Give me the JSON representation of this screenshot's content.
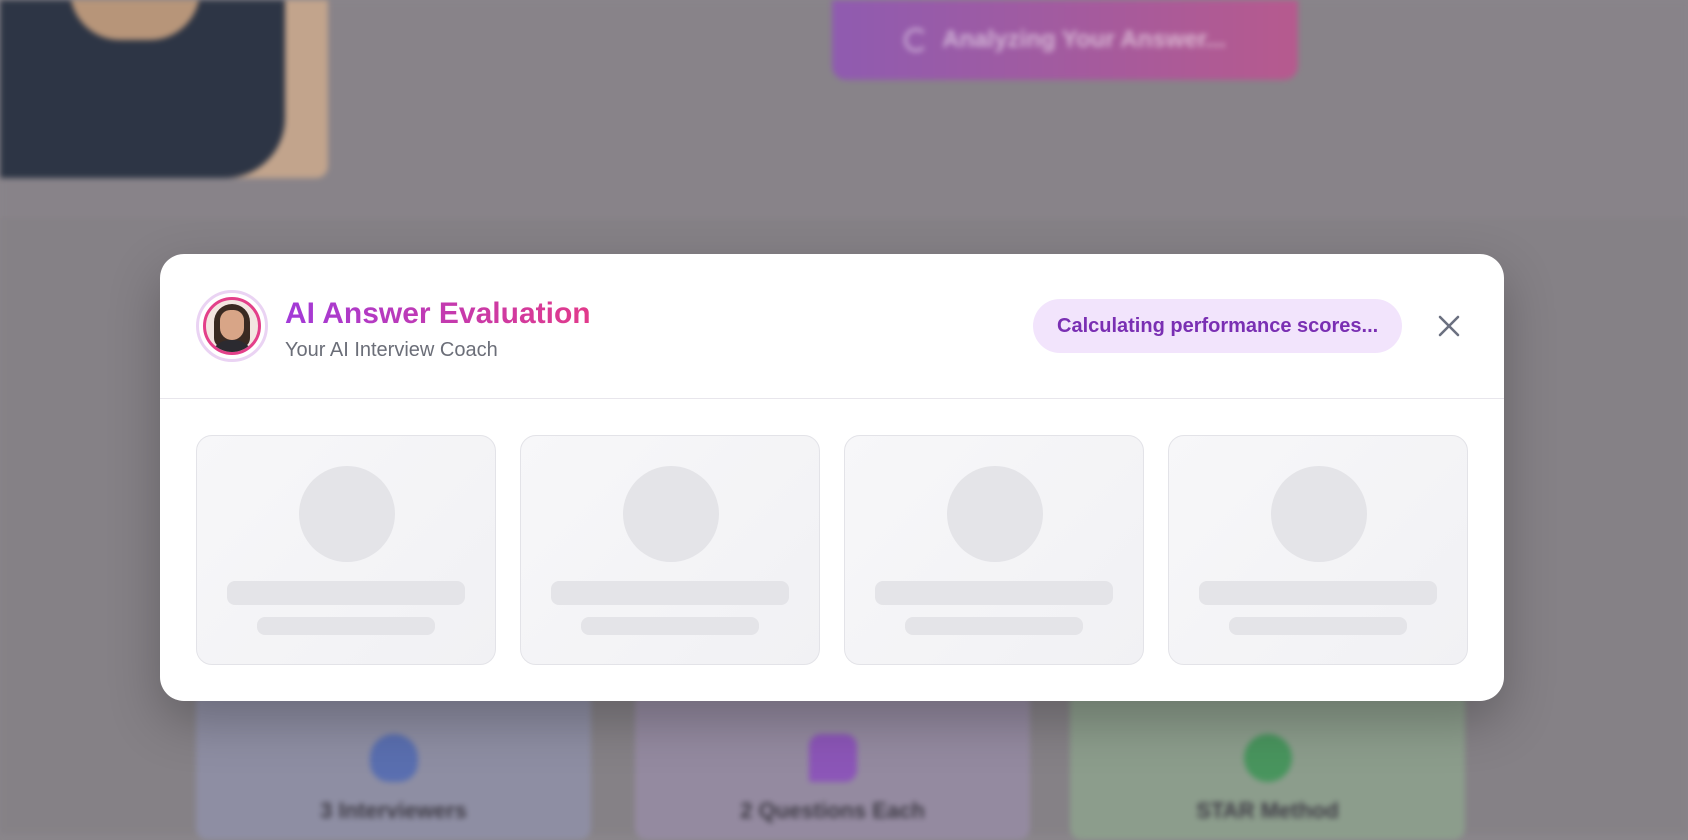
{
  "background": {
    "analyze_button_label": "Analyzing Your Answer...",
    "features": [
      {
        "icon": "interviewers-icon",
        "label": "3 Interviewers"
      },
      {
        "icon": "chat-bubble-icon",
        "label": "2 Questions Each"
      },
      {
        "icon": "star-method-icon",
        "label": "STAR Method"
      }
    ]
  },
  "modal": {
    "title": "AI Answer Evaluation",
    "subtitle": "Your AI Interview Coach",
    "status": "Calculating performance scores...",
    "close_icon": "close-icon",
    "skeleton_card_count": 4
  },
  "colors": {
    "title_gradient_start": "#a23ad8",
    "title_gradient_end": "#e23a8a",
    "status_pill_bg": "#f2e4fc",
    "status_pill_text": "#7a2fb3"
  }
}
